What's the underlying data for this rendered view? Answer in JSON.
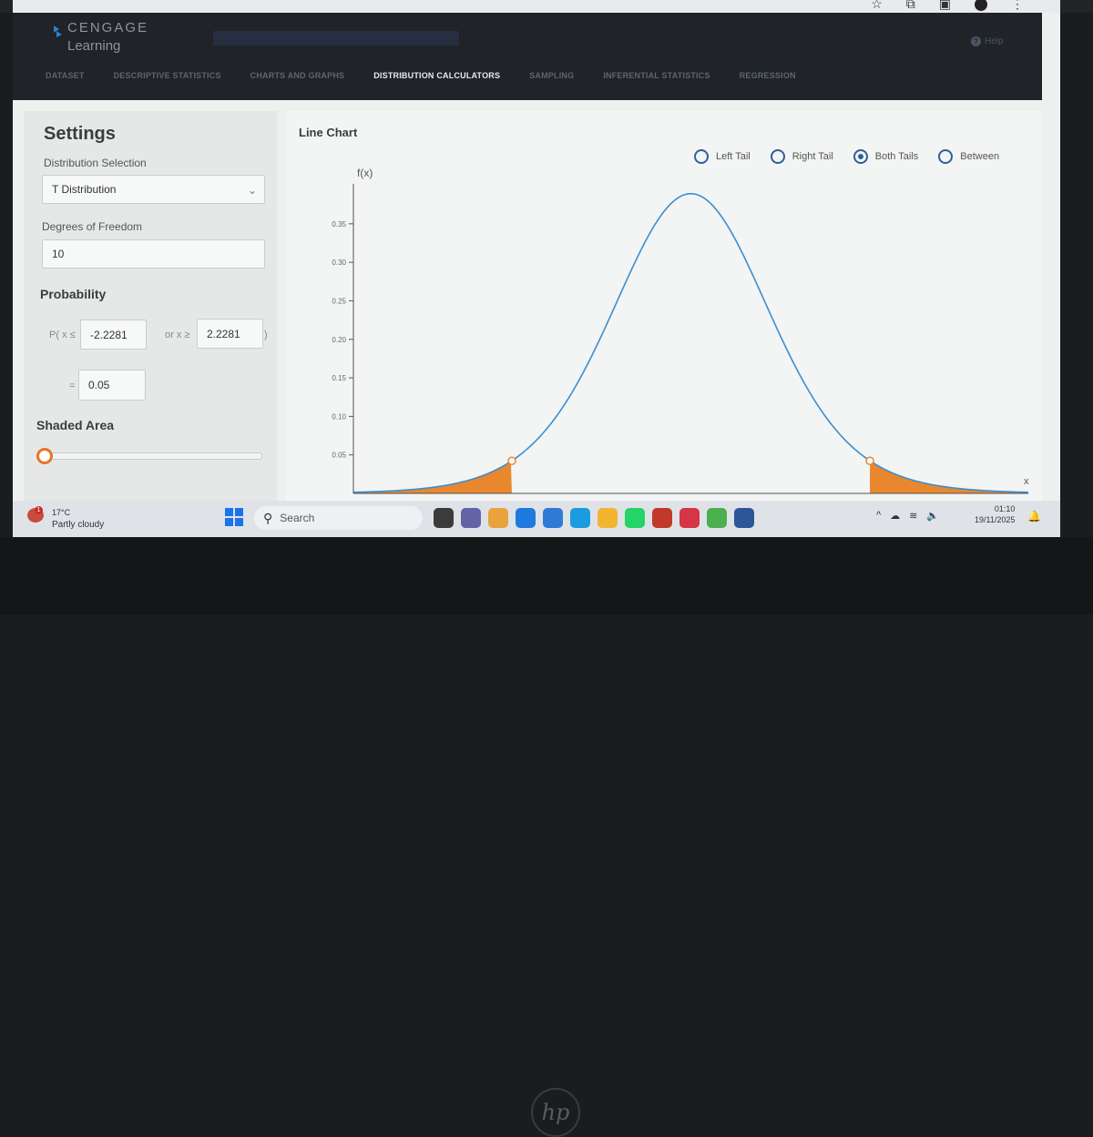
{
  "app": {
    "brand_line1": "CENGAGE",
    "brand_line2": "Learning",
    "help": "Help"
  },
  "nav": {
    "tabs": [
      "DATASET",
      "DESCRIPTIVE STATISTICS",
      "CHARTS AND GRAPHS",
      "DISTRIBUTION CALCULATORS",
      "SAMPLING",
      "INFERENTIAL STATISTICS",
      "REGRESSION"
    ],
    "active": "DISTRIBUTION CALCULATORS"
  },
  "settings": {
    "title": "Settings",
    "distribution_label": "Distribution Selection",
    "distribution_value": "T Distribution",
    "dof_label": "Degrees of Freedom",
    "dof_value": "10",
    "probability_label": "Probability",
    "prob_prefix": "P( x ≤",
    "lower_value": "-2.2281",
    "or_text": "or x ≥",
    "upper_value": "2.2281",
    "close_paren": ")",
    "equals": "=",
    "prob_value": "0.05",
    "shaded_label": "Shaded Area",
    "shaded_level": 0
  },
  "chart": {
    "title": "Line Chart",
    "radio_options": [
      "Left Tail",
      "Right Tail",
      "Both Tails",
      "Between"
    ],
    "selected_option": "Both Tails",
    "colors": {
      "curve": "#3a8fd0",
      "shade": "#e8872e",
      "axis": "#555555"
    }
  },
  "chart_data": {
    "type": "area",
    "title": "",
    "xlabel": "x",
    "ylabel": "f(x)",
    "y_ticks": [
      0.05,
      0.1,
      0.15,
      0.2,
      0.25,
      0.3,
      0.35
    ],
    "ylim": [
      0,
      0.39
    ],
    "xlim": [
      -4.2,
      4.2
    ],
    "distribution": "t",
    "degrees_of_freedom": 10,
    "shaded_regions": [
      [
        -4.2,
        -2.2281
      ],
      [
        2.2281,
        4.2
      ]
    ],
    "markers": [
      {
        "x": -2.2281,
        "y": 0.0422
      },
      {
        "x": 2.2281,
        "y": 0.0422
      }
    ]
  },
  "taskbar": {
    "temperature": "17°C",
    "weather": "Partly cloudy",
    "weather_badge": "1",
    "search": "Search",
    "time": "01:10",
    "date": "19/11/2025",
    "apps": [
      "file-explorer-icon",
      "teams-icon",
      "chrome-icon",
      "copilot-icon",
      "vscode-icon",
      "edge-icon",
      "folder-icon",
      "whatsapp-icon",
      "chrome-profile-icon",
      "app-red-icon",
      "utorrent-icon",
      "word-icon"
    ]
  }
}
